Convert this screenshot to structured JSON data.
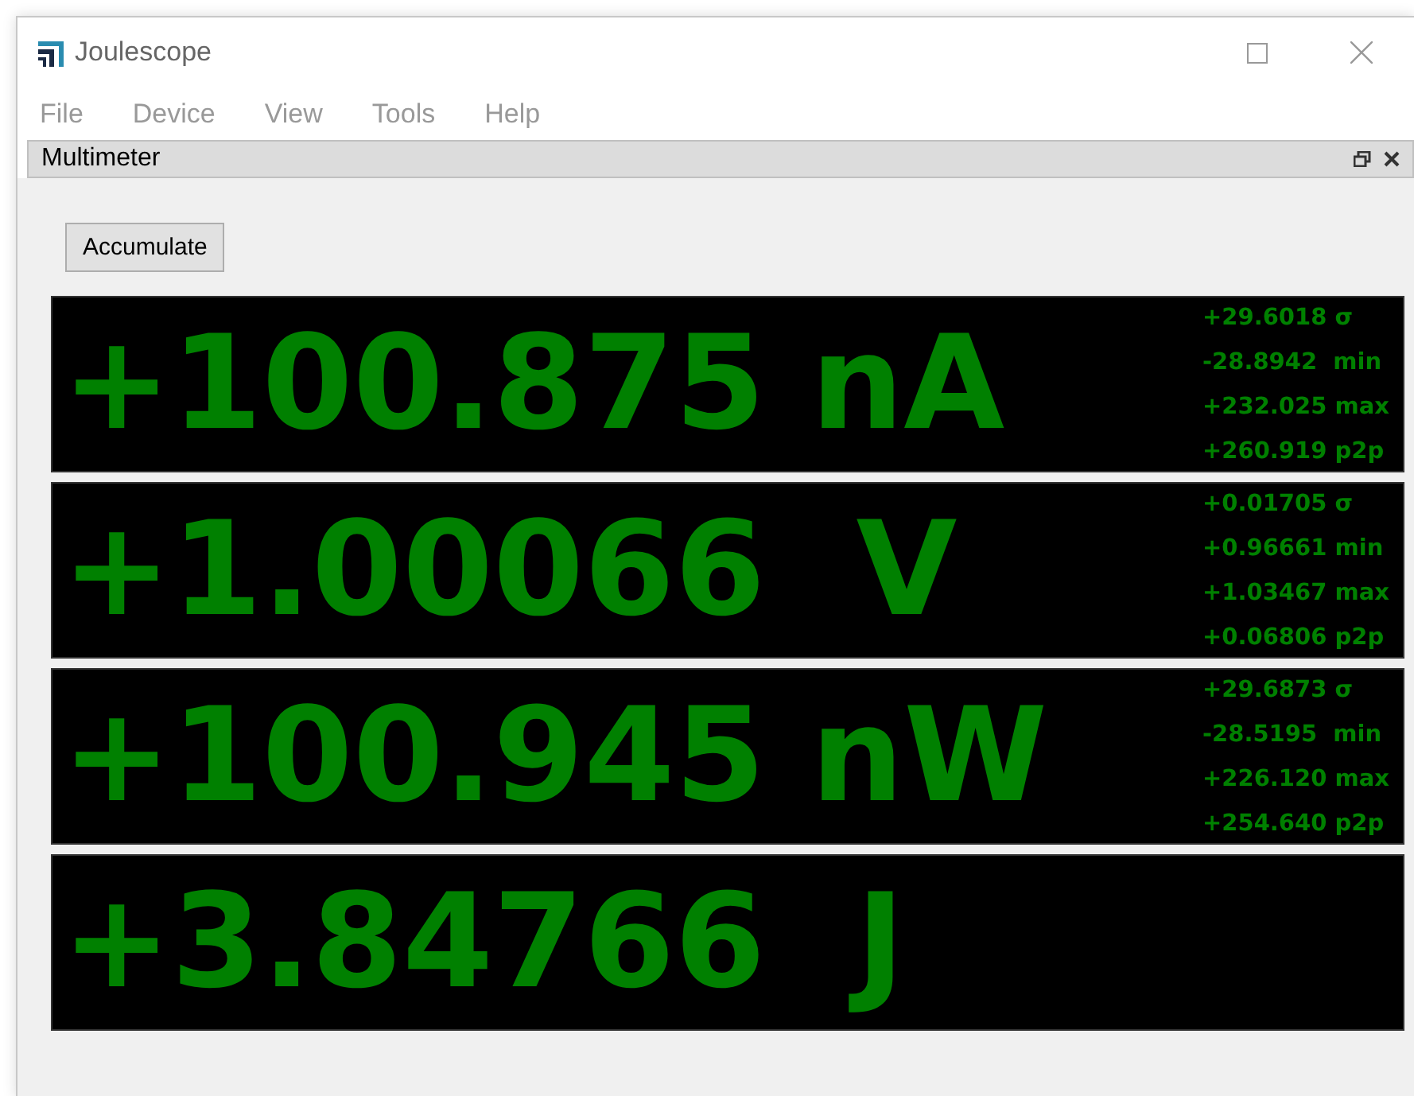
{
  "window": {
    "title": "Joulescope"
  },
  "menu": [
    "File",
    "Device",
    "View",
    "Tools",
    "Help"
  ],
  "dock": {
    "title": "Multimeter"
  },
  "accumulate_button": "Accumulate",
  "readings": [
    {
      "value": "+100.875 nA",
      "stats": [
        "+29.6018 σ",
        "-28.8942  min",
        "+232.025 max",
        "+260.919 p2p"
      ]
    },
    {
      "value": "+1.00066  V",
      "stats": [
        "+0.01705 σ",
        "+0.96661 min",
        "+1.03467 max",
        "+0.06806 p2p"
      ]
    },
    {
      "value": "+100.945 nW",
      "stats": [
        "+29.6873 σ",
        "-28.5195  min",
        "+226.120 max",
        "+254.640 p2p"
      ]
    },
    {
      "value": "+3.84766  J"
    }
  ]
}
